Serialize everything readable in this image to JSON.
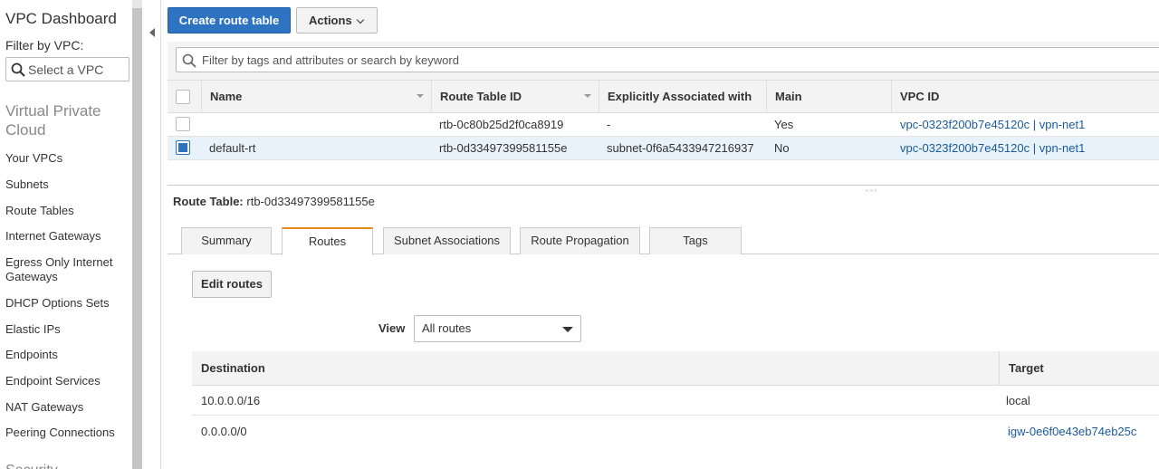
{
  "sidebar": {
    "title": "VPC Dashboard",
    "filter_label": "Filter by VPC:",
    "filter_placeholder": "Select a VPC",
    "section": "Virtual Private Cloud",
    "items": [
      "Your VPCs",
      "Subnets",
      "Route Tables",
      "Internet Gateways",
      "Egress Only Internet Gateways",
      "DHCP Options Sets",
      "Elastic IPs",
      "Endpoints",
      "Endpoint Services",
      "NAT Gateways",
      "Peering Connections"
    ],
    "next_section": "Security"
  },
  "toolbar": {
    "create_label": "Create route table",
    "actions_label": "Actions"
  },
  "search": {
    "placeholder": "Filter by tags and attributes or search by keyword"
  },
  "grid": {
    "columns": [
      "Name",
      "Route Table ID",
      "Explicitly Associated with",
      "Main",
      "VPC ID"
    ],
    "rows": [
      {
        "name": "",
        "id": "rtb-0c80b25d2f0ca8919",
        "assoc": "-",
        "main": "Yes",
        "vpc": "vpc-0323f200b7e45120c | vpn-net1",
        "selected": false
      },
      {
        "name": "default-rt",
        "id": "rtb-0d33497399581155e",
        "assoc": "subnet-0f6a5433947216937",
        "main": "No",
        "vpc": "vpc-0323f200b7e45120c | vpn-net1",
        "selected": true
      }
    ]
  },
  "detail": {
    "label": "Route Table:",
    "value": "rtb-0d33497399581155e",
    "tabs": [
      "Summary",
      "Routes",
      "Subnet Associations",
      "Route Propagation",
      "Tags"
    ],
    "active_tab": "Routes",
    "edit_label": "Edit routes",
    "view_label": "View",
    "view_value": "All routes",
    "routes_columns": [
      "Destination",
      "Target"
    ],
    "routes": [
      {
        "destination": "10.0.0.0/16",
        "target": "local"
      },
      {
        "destination": "0.0.0.0/0",
        "target": "igw-0e6f0e43eb74eb25c"
      }
    ]
  },
  "colors": {
    "primary": "#2e73c1",
    "link": "#1a5a9b",
    "active_tab": "#e48a1d",
    "selected_row": "#e7f2fb"
  }
}
